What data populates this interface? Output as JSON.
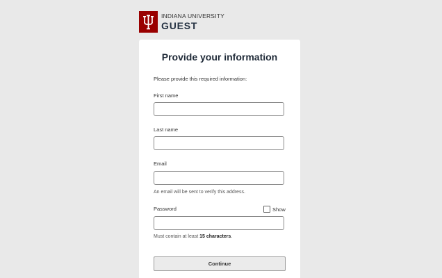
{
  "header": {
    "university": "INDIANA UNIVERSITY",
    "app_name": "GUEST",
    "logo_icon": "iu-trident-logo",
    "brand_color": "#990000"
  },
  "form": {
    "title": "Provide your information",
    "instructions": "Please provide this required information:",
    "first_name_label": "First name",
    "first_name_value": "",
    "last_name_label": "Last name",
    "last_name_value": "",
    "email_label": "Email",
    "email_value": "",
    "email_hint": "An email will be sent to verify this address.",
    "password_label": "Password",
    "password_value": "",
    "show_label": "Show",
    "show_checked": false,
    "password_hint_prefix": "Must contain at least ",
    "password_hint_bold": "15 characters",
    "password_hint_suffix": ".",
    "continue_label": "Continue"
  }
}
